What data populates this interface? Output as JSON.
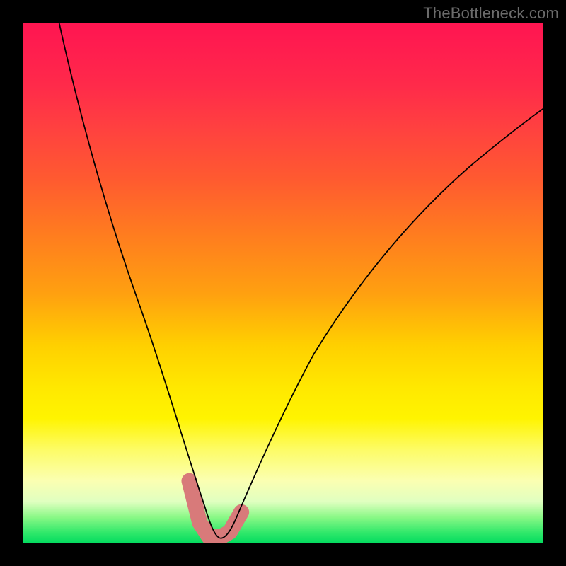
{
  "watermark": "TheBottleneck.com",
  "chart_data": {
    "type": "line",
    "title": "",
    "xlabel": "",
    "ylabel": "",
    "xlim": [
      0,
      1000
    ],
    "ylim": [
      0,
      1000
    ],
    "grid": false,
    "legend": false,
    "note": "Axes are unlabeled; coordinates are in plot-area units (0–1000). Curve is a V-shaped response dipping to the floor near x≈360 and rising on both sides.",
    "series": [
      {
        "name": "curve",
        "x": [
          70,
          100,
          140,
          180,
          220,
          260,
          300,
          330,
          350,
          370,
          390,
          410,
          440,
          500,
          560,
          640,
          740,
          860,
          1000
        ],
        "y": [
          1000,
          870,
          720,
          590,
          470,
          350,
          230,
          140,
          70,
          15,
          15,
          30,
          75,
          180,
          290,
          420,
          560,
          700,
          830
        ],
        "stroke": "#000000",
        "stroke_width": 2
      },
      {
        "name": "floor-marker",
        "x": [
          320,
          340,
          360,
          380,
          400,
          420
        ],
        "y": [
          120,
          40,
          12,
          12,
          22,
          60
        ],
        "stroke": "#d87a7a",
        "stroke_width": 22
      }
    ],
    "background_gradient": {
      "direction": "top-to-bottom",
      "stops": [
        {
          "pos": 0.0,
          "color": "#ff1551"
        },
        {
          "pos": 0.2,
          "color": "#ff4040"
        },
        {
          "pos": 0.4,
          "color": "#ff7a20"
        },
        {
          "pos": 0.62,
          "color": "#ffd000"
        },
        {
          "pos": 0.82,
          "color": "#fdfc66"
        },
        {
          "pos": 0.95,
          "color": "#89f886"
        },
        {
          "pos": 1.0,
          "color": "#02db5f"
        }
      ]
    }
  }
}
